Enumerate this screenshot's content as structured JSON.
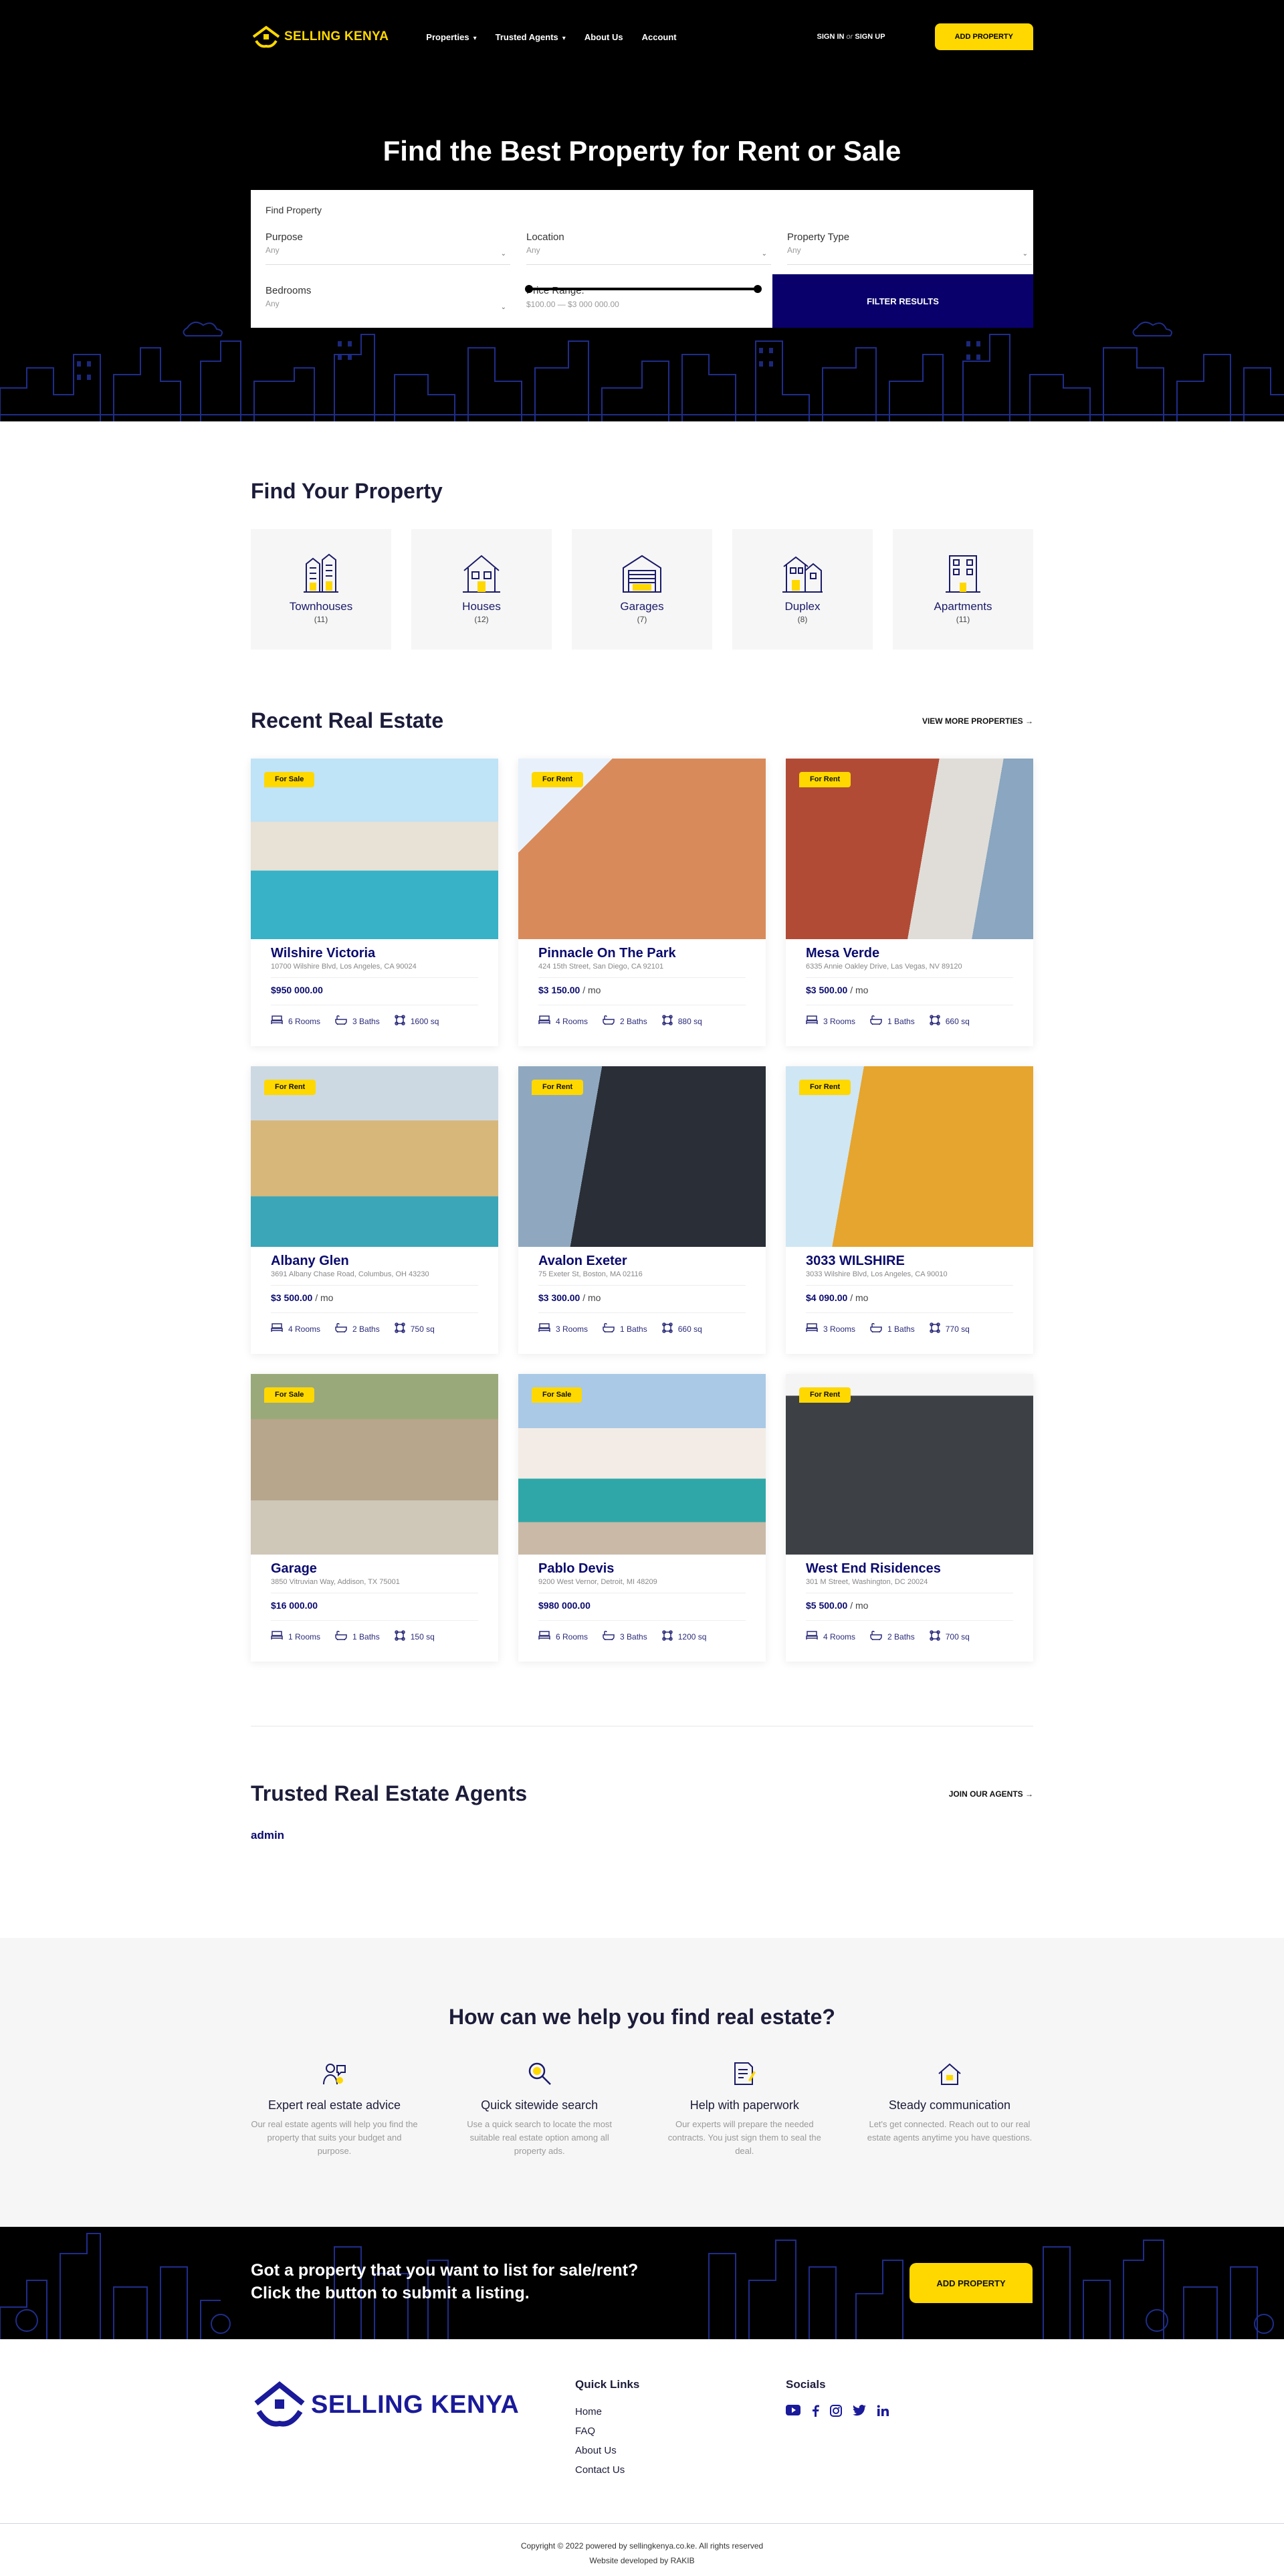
{
  "brand": {
    "name": "SELLING KENYA",
    "accent": "#ffd800",
    "navy": "#0a006b"
  },
  "nav": {
    "items": [
      "Properties",
      "Trusted Agents",
      "About Us",
      "Account"
    ],
    "sign_in": "SIGN IN",
    "or": "or",
    "sign_up": "SIGN UP",
    "add_property": "ADD PROPERTY"
  },
  "hero": {
    "title": "Find the Best Property for Rent or Sale"
  },
  "search": {
    "title": "Find Property",
    "purpose_label": "Purpose",
    "purpose_value": "Any",
    "location_label": "Location",
    "location_value": "Any",
    "type_label": "Property Type",
    "type_value": "Any",
    "bedrooms_label": "Bedrooms",
    "bedrooms_value": "Any",
    "price_label": "Price Range:",
    "price_value": "$100.00 — $3 000 000.00",
    "filter_button": "FILTER RESULTS"
  },
  "types": {
    "title": "Find Your Property",
    "items": [
      {
        "name": "Townhouses",
        "count": "(11)",
        "icon": "townhouse-icon"
      },
      {
        "name": "Houses",
        "count": "(12)",
        "icon": "house-icon"
      },
      {
        "name": "Garages",
        "count": "(7)",
        "icon": "garage-icon"
      },
      {
        "name": "Duplex",
        "count": "(8)",
        "icon": "duplex-icon"
      },
      {
        "name": "Apartments",
        "count": "(11)",
        "icon": "apartment-icon"
      }
    ]
  },
  "recent": {
    "title": "Recent Real Estate",
    "more": "VIEW MORE PROPERTIES",
    "listings": [
      {
        "badge": "For Sale",
        "name": "Wilshire Victoria",
        "address": "10700 Wilshire Blvd, Los Angeles, CA 90024",
        "price": "$950 000.00",
        "per": "",
        "rooms": "6 Rooms",
        "baths": "3 Baths",
        "area": "1600 sq"
      },
      {
        "badge": "For Rent",
        "name": "Pinnacle On The Park",
        "address": "424 15th Street, San Diego, CA 92101",
        "price": "$3 150.00",
        "per": "/ mo",
        "rooms": "4 Rooms",
        "baths": "2 Baths",
        "area": "880 sq"
      },
      {
        "badge": "For Rent",
        "name": "Mesa Verde",
        "address": "6335 Annie Oakley Drive, Las Vegas, NV 89120",
        "price": "$3 500.00",
        "per": "/ mo",
        "rooms": "3 Rooms",
        "baths": "1 Baths",
        "area": "660 sq"
      },
      {
        "badge": "For Rent",
        "name": "Albany Glen",
        "address": "3691 Albany Chase Road, Columbus, OH 43230",
        "price": "$3 500.00",
        "per": "/ mo",
        "rooms": "4 Rooms",
        "baths": "2 Baths",
        "area": "750 sq"
      },
      {
        "badge": "For Rent",
        "name": "Avalon Exeter",
        "address": "75 Exeter St, Boston, MA 02116",
        "price": "$3 300.00",
        "per": "/ mo",
        "rooms": "3 Rooms",
        "baths": "1 Baths",
        "area": "660 sq"
      },
      {
        "badge": "For Rent",
        "name": "3033 WILSHIRE",
        "address": "3033 Wilshire Blvd, Los Angeles, CA 90010",
        "price": "$4 090.00",
        "per": "/ mo",
        "rooms": "3 Rooms",
        "baths": "1 Baths",
        "area": "770 sq"
      },
      {
        "badge": "For Sale",
        "name": "Garage",
        "address": "3850 Vitruvian Way, Addison, TX 75001",
        "price": "$16 000.00",
        "per": "",
        "rooms": "1 Rooms",
        "baths": "1 Baths",
        "area": "150 sq"
      },
      {
        "badge": "For Sale",
        "name": "Pablo Devis",
        "address": "9200 West Vernor, Detroit, MI 48209",
        "price": "$980 000.00",
        "per": "",
        "rooms": "6 Rooms",
        "baths": "3 Baths",
        "area": "1200 sq"
      },
      {
        "badge": "For Rent",
        "name": "West End Risidences",
        "address": "301 M Street, Washington, DC 20024",
        "price": "$5 500.00",
        "per": "/ mo",
        "rooms": "4 Rooms",
        "baths": "2 Baths",
        "area": "700 sq"
      }
    ]
  },
  "agents": {
    "title": "Trusted Real Estate Agents",
    "join": "JOIN OUR AGENTS",
    "first_agent": "admin"
  },
  "help": {
    "title": "How can we help you find real estate?",
    "items": [
      {
        "title": "Expert real estate advice",
        "text": "Our real estate agents will help you find the property that suits your budget and purpose.",
        "icon": "advice-icon"
      },
      {
        "title": "Quick sitewide search",
        "text": "Use a quick search to locate the most suitable real estate option among all property ads.",
        "icon": "search-icon"
      },
      {
        "title": "Help with paperwork",
        "text": "Our experts will prepare the needed contracts. You just sign them to seal the deal.",
        "icon": "paperwork-icon"
      },
      {
        "title": "Steady communication",
        "text": "Let's get connected. Reach out to our real estate agents anytime you have questions.",
        "icon": "communication-icon"
      }
    ]
  },
  "cta": {
    "line1": "Got a property that you want to list for sale/rent?",
    "line2": "Click the button to submit a listing.",
    "button": "ADD PROPERTY"
  },
  "footer": {
    "quick_title": "Quick Links",
    "links": [
      "Home",
      "FAQ",
      "About Us",
      "Contact Us"
    ],
    "social_title": "Socials",
    "socials": [
      "youtube-icon",
      "facebook-icon",
      "instagram-icon",
      "twitter-icon",
      "linkedin-icon"
    ],
    "copyright": "Copyright © 2022 powered by sellingkenya.co.ke. All rights reserved",
    "developer": "Website developed by RAKIB"
  }
}
